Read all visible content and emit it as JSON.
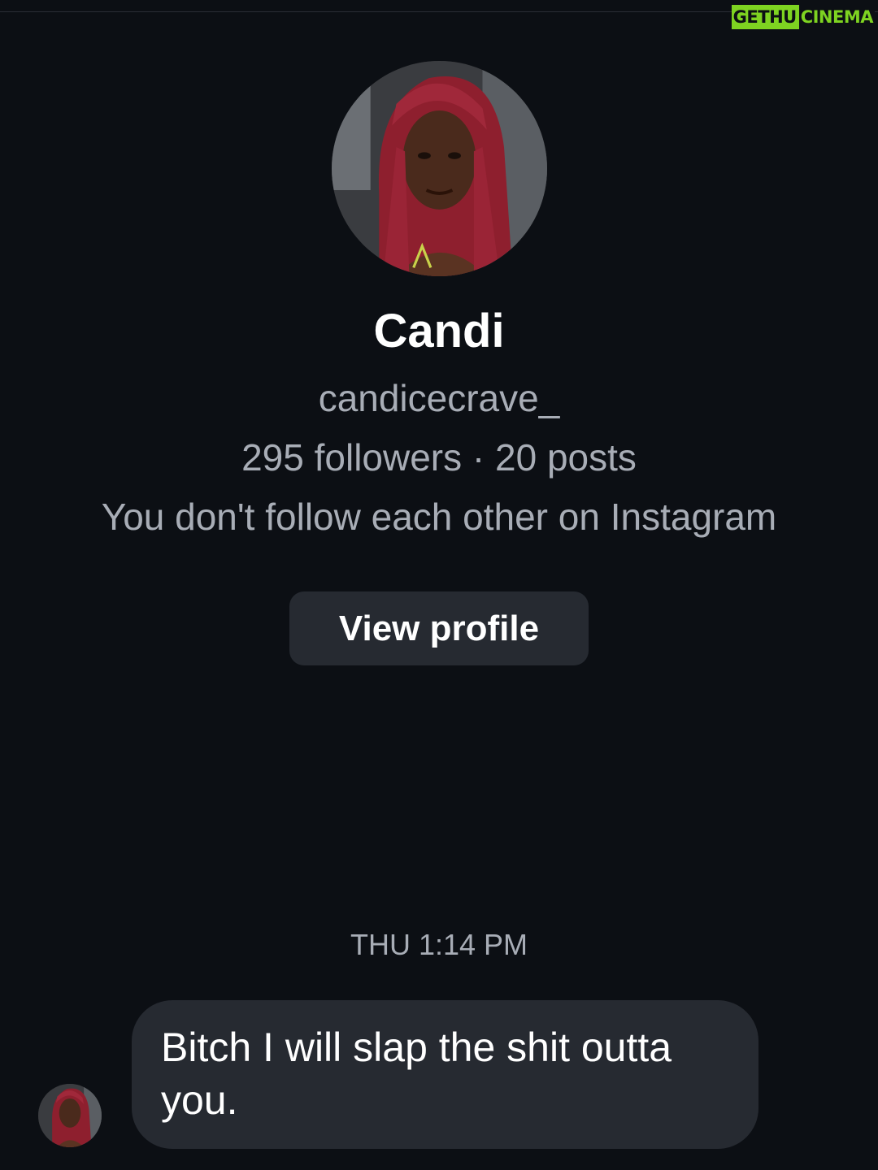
{
  "watermark": {
    "left": "GETHU",
    "right": "CINEMA"
  },
  "profile": {
    "display_name": "Candi",
    "username": "candicecrave_",
    "stats": "295 followers · 20 posts",
    "follow_note": "You don't follow each other on Instagram",
    "view_profile_label": "View profile"
  },
  "thread": {
    "timestamp": "THU 1:14 PM",
    "messages": [
      {
        "sender": "Candi",
        "text": "Bitch I will slap the shit outta you."
      }
    ]
  },
  "colors": {
    "background": "#0c0f14",
    "secondary_text": "#a8adb6",
    "bubble": "#262a31",
    "watermark_green": "#7ed321"
  }
}
